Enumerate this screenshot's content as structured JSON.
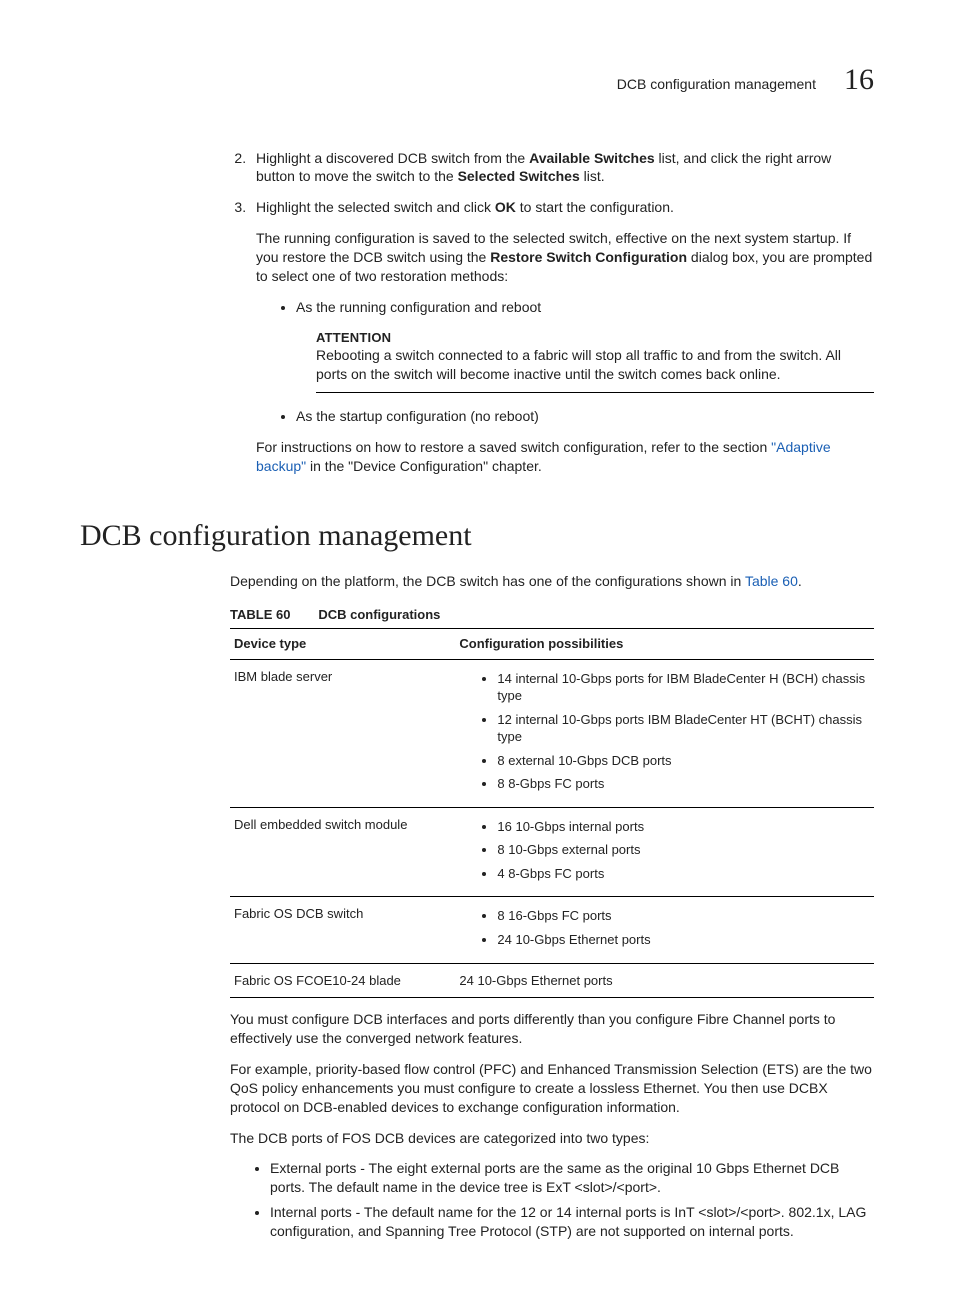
{
  "header": {
    "title": "DCB configuration management",
    "chapter": "16"
  },
  "steps": {
    "s2_pre": "Highlight a discovered DCB switch from the ",
    "s2_b1": "Available Switches",
    "s2_mid": " list, and click the right arrow button to move the switch to the ",
    "s2_b2": "Selected Switches",
    "s2_post": " list.",
    "s3_pre": "Highlight the selected switch and click ",
    "s3_b1": "OK",
    "s3_post": " to start the configuration.",
    "s3_run_pre": "The running configuration is saved to the selected switch, effective on the next system startup. If you restore the DCB switch using the ",
    "s3_run_b": "Restore Switch Configuration",
    "s3_run_post": " dialog box, you are prompted to select one of two restoration methods:",
    "opt1": "As the running configuration and reboot",
    "opt2": "As the startup configuration (no reboot)",
    "att_label": "ATTENTION",
    "att_body": "Rebooting a switch connected to a fabric will stop all traffic to and from the switch. All ports on the switch will become inactive until the switch comes back online.",
    "restore_pre": "For instructions on how to restore a saved switch configuration, refer to the section ",
    "restore_link": "\"Adaptive backup\"",
    "restore_post": " in the \"Device Configuration\" chapter."
  },
  "section_heading": "DCB configuration management",
  "intro_pre": "Depending on the platform, the DCB switch has one of the configurations shown in ",
  "intro_link": "Table 60",
  "intro_post": ".",
  "table": {
    "label": "TABLE 60",
    "caption": "DCB configurations",
    "col1": "Device type",
    "col2": "Configuration possibilities",
    "rows": [
      {
        "device": "IBM blade server",
        "items": [
          "14 internal 10-Gbps ports for IBM BladeCenter H (BCH) chassis type",
          "12 internal 10-Gbps ports IBM BladeCenter HT (BCHT) chassis type",
          "8 external 10-Gbps DCB ports",
          "8 8-Gbps FC ports"
        ]
      },
      {
        "device": "Dell embedded switch module",
        "items": [
          "16 10-Gbps internal ports",
          "8 10-Gbps external ports",
          "4 8-Gbps FC ports"
        ]
      },
      {
        "device": "Fabric OS DCB switch",
        "items": [
          "8 16-Gbps FC ports",
          "24 10-Gbps Ethernet ports"
        ]
      },
      {
        "device": "Fabric OS FCOE10-24 blade",
        "plain": "24 10-Gbps Ethernet ports"
      }
    ]
  },
  "body": {
    "p1": "You must configure DCB interfaces and ports differently than you configure Fibre Channel ports to effectively use the converged network features.",
    "p2": "For example, priority-based flow control (PFC) and Enhanced Transmission Selection (ETS) are the two QoS policy enhancements you must configure to create a lossless Ethernet. You then use DCBX protocol on DCB-enabled devices to exchange configuration information.",
    "p3": "The DCB ports of FOS DCB devices are categorized into two types:",
    "ports": [
      "External ports - The eight external ports are the same as the original 10 Gbps Ethernet DCB ports. The default name in the device tree is ExT <slot>/<port>.",
      "Internal ports - The default name for the 12 or 14 internal ports is InT <slot>/<port>. 802.1x, LAG configuration, and Spanning Tree Protocol (STP) are not supported on internal ports."
    ]
  }
}
